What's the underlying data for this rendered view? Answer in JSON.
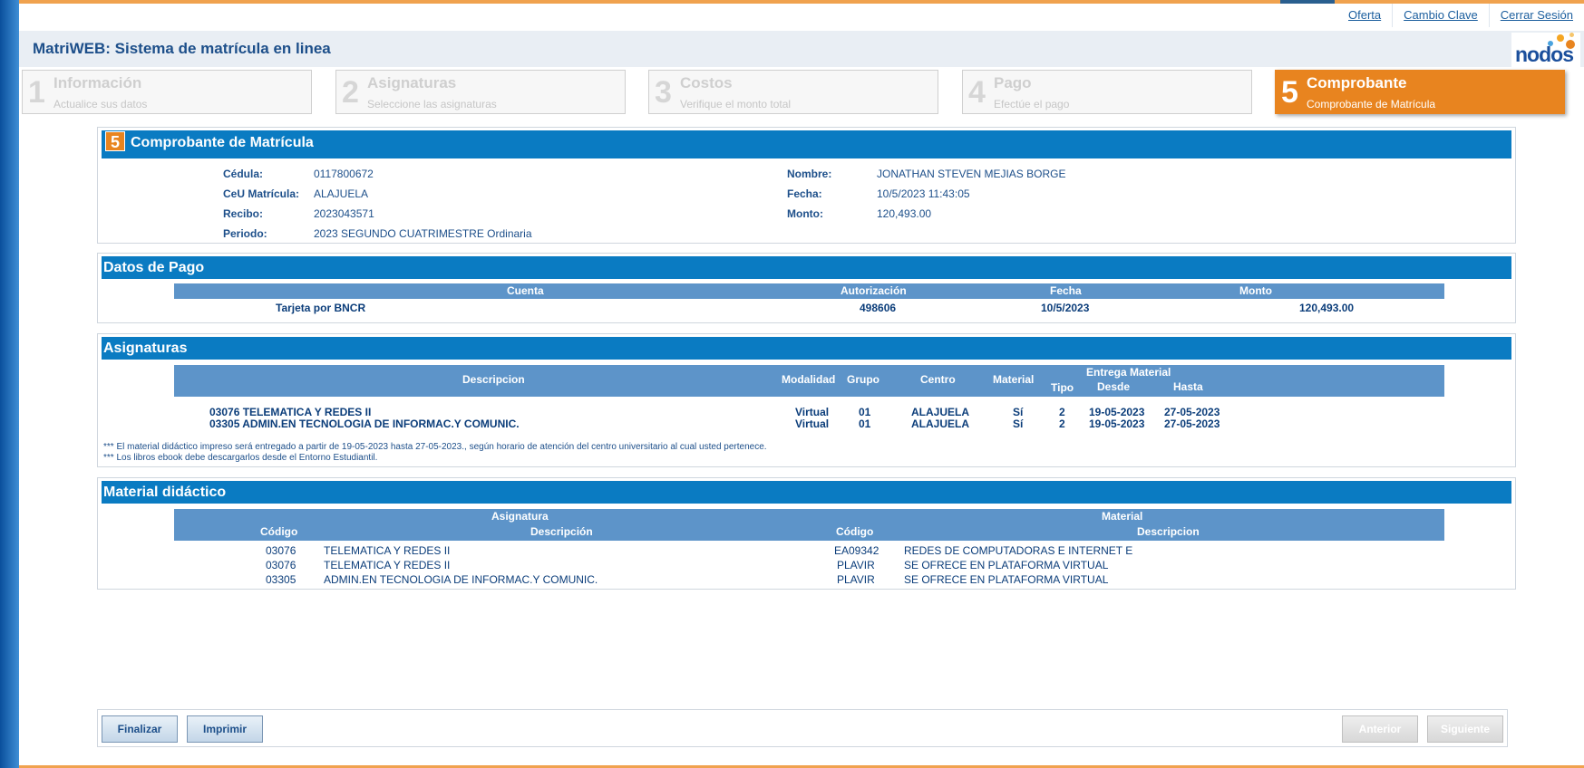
{
  "top_links": [
    "Oferta",
    "Cambio Clave",
    "Cerrar Sesión"
  ],
  "header": {
    "title": "MatriWEB: Sistema de matrícula en linea",
    "logo_text": "nodos"
  },
  "steps": [
    {
      "num": "1",
      "label": "Información",
      "sub": "Actualice sus datos",
      "active": false
    },
    {
      "num": "2",
      "label": "Asignaturas",
      "sub": "Seleccione las asignaturas",
      "active": false
    },
    {
      "num": "3",
      "label": "Costos",
      "sub": "Verifique el monto total",
      "active": false
    },
    {
      "num": "4",
      "label": "Pago",
      "sub": "Efectúe el pago",
      "active": false
    },
    {
      "num": "5",
      "label": "Comprobante",
      "sub": "Comprobante de Matrícula",
      "active": true
    }
  ],
  "comprobante": {
    "badge": "5",
    "title": "Comprobante de Matrícula",
    "left": [
      {
        "key": "Cédula:",
        "value": "0117800672"
      },
      {
        "key": "CeU Matrícula:",
        "value": "ALAJUELA"
      },
      {
        "key": "Recibo:",
        "value": "2023043571"
      },
      {
        "key": "Periodo:",
        "value": "2023 SEGUNDO CUATRIMESTRE Ordinaria"
      }
    ],
    "right": [
      {
        "key": "Nombre:",
        "value": "JONATHAN STEVEN MEJIAS BORGE"
      },
      {
        "key": "Fecha:",
        "value": "10/5/2023 11:43:05"
      },
      {
        "key": "Monto:",
        "value": "120,493.00"
      }
    ]
  },
  "pago": {
    "title": "Datos de Pago",
    "headers": [
      "Cuenta",
      "Autorización",
      "Fecha",
      "Monto"
    ],
    "row": [
      "Tarjeta por BNCR",
      "498606",
      "10/5/2023",
      "120,493.00"
    ]
  },
  "asignaturas": {
    "title": "Asignaturas",
    "headers": {
      "descripcion": "Descripcion",
      "modalidad": "Modalidad",
      "grupo": "Grupo",
      "centro": "Centro",
      "material": "Material",
      "entrega": "Entrega Material",
      "tipo": "Tipo",
      "desde": "Desde",
      "hasta": "Hasta"
    },
    "rows": [
      [
        "03076 TELEMATICA Y REDES II",
        "Virtual",
        "01",
        "ALAJUELA",
        "Sí",
        "2",
        "19-05-2023",
        "27-05-2023"
      ],
      [
        "03305 ADMIN.EN TECNOLOGIA DE INFORMAC.Y COMUNIC.",
        "Virtual",
        "01",
        "ALAJUELA",
        "Sí",
        "2",
        "19-05-2023",
        "27-05-2023"
      ]
    ],
    "notes": [
      "*** El material didáctico impreso será entregado a partir de 19-05-2023 hasta 27-05-2023., según horario de atención del centro universitario al cual usted pertenece.",
      "*** Los libros ebook debe descargarlos desde el Entorno Estudiantil."
    ]
  },
  "material": {
    "title": "Material didáctico",
    "group_headers": [
      "Asignatura",
      "Material"
    ],
    "headers": [
      "Código",
      "Descripción",
      "Código",
      "Descripcion"
    ],
    "rows": [
      [
        "03076",
        "TELEMATICA Y REDES II",
        "EA09342",
        "REDES DE COMPUTADORAS E INTERNET E"
      ],
      [
        "03076",
        "TELEMATICA Y REDES II",
        "PLAVIR",
        "SE OFRECE EN PLATAFORMA VIRTUAL"
      ],
      [
        "03305",
        "ADMIN.EN TECNOLOGIA DE INFORMAC.Y COMUNIC.",
        "PLAVIR",
        "SE OFRECE EN PLATAFORMA VIRTUAL"
      ]
    ]
  },
  "buttons": {
    "finalizar": "Finalizar",
    "imprimir": "Imprimir",
    "anterior": "Anterior",
    "siguiente": "Siguiente"
  },
  "colors": {
    "accent": "#e8841f",
    "section_bar": "#0a7bc2",
    "table_header": "#5d94c9",
    "text": "#1d4f8a"
  }
}
